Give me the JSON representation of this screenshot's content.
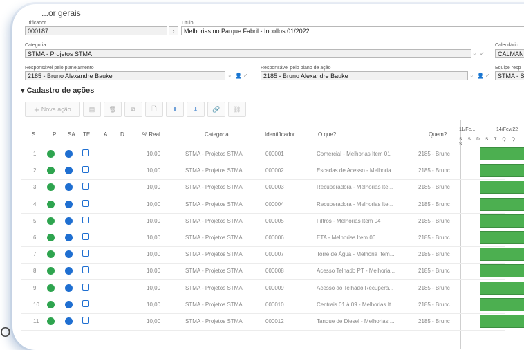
{
  "section_title": "...or gerais",
  "fields": {
    "identificador_label": "...tificador",
    "identificador_value": "000187",
    "titulo_label": "Título",
    "titulo_value": "Melhorias no Parque Fabril - Incollos 01/2022",
    "calendario_label": "Calendário",
    "calendario_value": "CALMAN",
    "categoria_label": "Categoria",
    "categoria_value": "STMA - Projetos STMA",
    "resp_planejamento_label": "Responsável pelo planejamento",
    "resp_planejamento_value": "2185 - Bruno Alexandre Bauke",
    "resp_plano_label": "Responsável pelo plano de ação",
    "resp_plano_value": "2185 - Bruno Alexandre Bauke",
    "equipe_label": "Equipe resp",
    "equipe_value": "STMA - S"
  },
  "cadastro_title": "Cadastro de ações",
  "toolbar": {
    "nova_acao": "Nova ação"
  },
  "columns": [
    "S...",
    "P",
    "SA",
    "TE",
    "A",
    "D",
    "% Real",
    "Categoria",
    "Identificador",
    "O que?",
    "Quem?"
  ],
  "gantt": {
    "date1": "11/Fe...",
    "date2": "14/Fev/22",
    "days": "S S D S T Q Q S"
  },
  "rows": [
    {
      "n": "1",
      "real": "10,00",
      "cat": "STMA - Projetos STMA",
      "id": "000001",
      "oque": "Comercial - Melhorias Item 01",
      "quem": "2185 - Brunc"
    },
    {
      "n": "2",
      "real": "10,00",
      "cat": "STMA - Projetos STMA",
      "id": "000002",
      "oque": "Escadas de Acesso - Melhoria",
      "quem": "2185 - Brunc"
    },
    {
      "n": "3",
      "real": "10,00",
      "cat": "STMA - Projetos STMA",
      "id": "000003",
      "oque": "Recuperadora - Melhorias Ite...",
      "quem": "2185 - Brunc"
    },
    {
      "n": "4",
      "real": "10,00",
      "cat": "STMA - Projetos STMA",
      "id": "000004",
      "oque": "Recuperadora - Melhorias Ite...",
      "quem": "2185 - Brunc"
    },
    {
      "n": "5",
      "real": "10,00",
      "cat": "STMA - Projetos STMA",
      "id": "000005",
      "oque": "Filtros - Melhorias Item 04",
      "quem": "2185 - Brunc"
    },
    {
      "n": "6",
      "real": "10,00",
      "cat": "STMA - Projetos STMA",
      "id": "000006",
      "oque": "ETA - Melhorias Item 06",
      "quem": "2185 - Brunc"
    },
    {
      "n": "7",
      "real": "10,00",
      "cat": "STMA - Projetos STMA",
      "id": "000007",
      "oque": "Torre de Água - Melhoria Item...",
      "quem": "2185 - Brunc"
    },
    {
      "n": "8",
      "real": "10,00",
      "cat": "STMA - Projetos STMA",
      "id": "000008",
      "oque": "Acesso Telhado PT - Melhoria...",
      "quem": "2185 - Brunc"
    },
    {
      "n": "9",
      "real": "10,00",
      "cat": "STMA - Projetos STMA",
      "id": "000009",
      "oque": "Acesso ao Telhado Recupera...",
      "quem": "2185 - Brunc"
    },
    {
      "n": "10",
      "real": "10,00",
      "cat": "STMA - Projetos STMA",
      "id": "000010",
      "oque": "Centrais 01 à 09 - Melhorias It...",
      "quem": "2185 - Brunc"
    },
    {
      "n": "11",
      "real": "10,00",
      "cat": "STMA - Projetos STMA",
      "id": "000012",
      "oque": "Tanque de Diesel - Melhorias ...",
      "quem": "2185 - Brunc"
    }
  ],
  "logo_letter": "O"
}
